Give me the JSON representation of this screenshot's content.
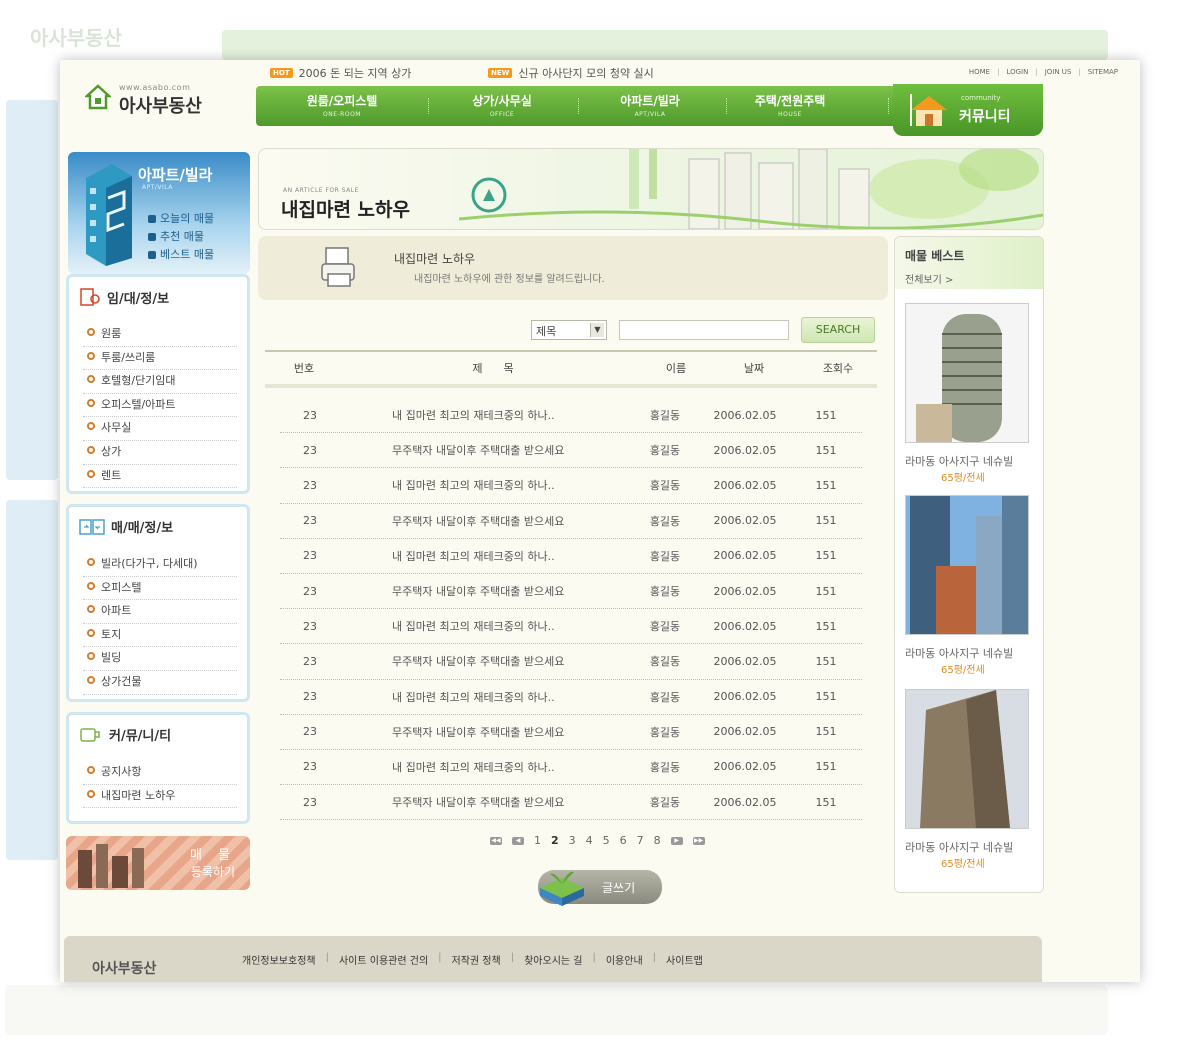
{
  "logo": {
    "url": "www.asabo.com",
    "name": "아사부동산"
  },
  "top_news": [
    {
      "badge": "HOT",
      "text": "2006 돈 되는 지역 상가"
    },
    {
      "badge": "NEW",
      "text": "신규 아사단지 모의 청약 실시"
    }
  ],
  "util_links": [
    "HOME",
    "LOGIN",
    "JOIN US",
    "SITEMAP"
  ],
  "main_nav": [
    {
      "ko": "원룸/오피스텔",
      "en": "ONE-ROOM"
    },
    {
      "ko": "상가/사무실",
      "en": "OFFICE"
    },
    {
      "ko": "아파트/빌라",
      "en": "APT/VILA"
    },
    {
      "ko": "주택/전원주택",
      "en": "HOUSE"
    }
  ],
  "community": {
    "en": "community",
    "ko": "커뮤니티"
  },
  "side_top": {
    "title": "아파트/빌라",
    "sub": "APT/VILA",
    "links": [
      "오늘의 매물",
      "추천 매물",
      "베스트 매물"
    ]
  },
  "side_boxes": [
    {
      "title": "임/대/정/보",
      "items": [
        "원룸",
        "투룸/쓰리룸",
        "호텔형/단기임대",
        "오피스텔/아파트",
        "사무실",
        "상가",
        "렌트"
      ]
    },
    {
      "title": "매/매/정/보",
      "items": [
        "빌라(다가구, 다세대)",
        "오피스텔",
        "아파트",
        "토지",
        "빌딩",
        "상가건물"
      ]
    },
    {
      "title": "커/뮤/니/티",
      "items": [
        "공지사항",
        "내집마련 노하우"
      ]
    }
  ],
  "register_banner": {
    "line1": "매 물",
    "line2": "등록하기"
  },
  "hero": {
    "en": "AN ARTICLE FOR SALE",
    "ko": "내집마련 노하우"
  },
  "info": {
    "title": "내집마련 노하우",
    "desc": "내집마련 노하우에 관한 정보를 알려드립니다."
  },
  "search": {
    "select": "제목",
    "button": "SEARCH"
  },
  "table": {
    "headers": [
      "번호",
      "제      목",
      "이름",
      "날짜",
      "조회수"
    ],
    "rows": [
      [
        "23",
        "내 집마련 최고의 재테크중의 하나..",
        "홍길동",
        "2006.02.05",
        "151"
      ],
      [
        "23",
        "무주택자 내달이후 주택대출 받으세요",
        "홍길동",
        "2006.02.05",
        "151"
      ],
      [
        "23",
        "내 집마련 최고의 재테크중의 하나..",
        "홍길동",
        "2006.02.05",
        "151"
      ],
      [
        "23",
        "무주택자 내달이후 주택대출 받으세요",
        "홍길동",
        "2006.02.05",
        "151"
      ],
      [
        "23",
        "내 집마련 최고의 재테크중의 하나..",
        "홍길동",
        "2006.02.05",
        "151"
      ],
      [
        "23",
        "무주택자 내달이후 주택대출 받으세요",
        "홍길동",
        "2006.02.05",
        "151"
      ],
      [
        "23",
        "내 집마련 최고의 재테크중의 하나..",
        "홍길동",
        "2006.02.05",
        "151"
      ],
      [
        "23",
        "무주택자 내달이후 주택대출 받으세요",
        "홍길동",
        "2006.02.05",
        "151"
      ],
      [
        "23",
        "내 집마련 최고의 재테크중의 하나..",
        "홍길동",
        "2006.02.05",
        "151"
      ],
      [
        "23",
        "무주택자 내달이후 주택대출 받으세요",
        "홍길동",
        "2006.02.05",
        "151"
      ],
      [
        "23",
        "내 집마련 최고의 재테크중의 하나..",
        "홍길동",
        "2006.02.05",
        "151"
      ],
      [
        "23",
        "무주택자 내달이후 주택대출 받으세요",
        "홍길동",
        "2006.02.05",
        "151"
      ]
    ]
  },
  "pagination": {
    "pages": [
      "1",
      "2",
      "3",
      "4",
      "5",
      "6",
      "7",
      "8"
    ],
    "current": "2"
  },
  "write_button": "글쓰기",
  "right_col": {
    "title": "매물 베스트",
    "more": "전체보기 >",
    "items": [
      {
        "name": "라마동 아사지구 네슈빌",
        "info": "65평/전세"
      },
      {
        "name": "라마동 아사지구 네슈빌",
        "info": "65평/전세"
      },
      {
        "name": "라마동 아사지구 네슈빌",
        "info": "65평/전세"
      }
    ]
  },
  "footer": {
    "logo": "아사부동산",
    "links": [
      "개인정보보호정책",
      "사이트 이용관련 건의",
      "저작권 정책",
      "찾아오시는 길",
      "이용안내",
      "사이트맵"
    ]
  },
  "colors": {
    "nav_green": "#5aa833",
    "accent_orange": "#e08a1e",
    "side_blue": "#3a8cc7",
    "bg_cream": "#fcfbf2"
  }
}
